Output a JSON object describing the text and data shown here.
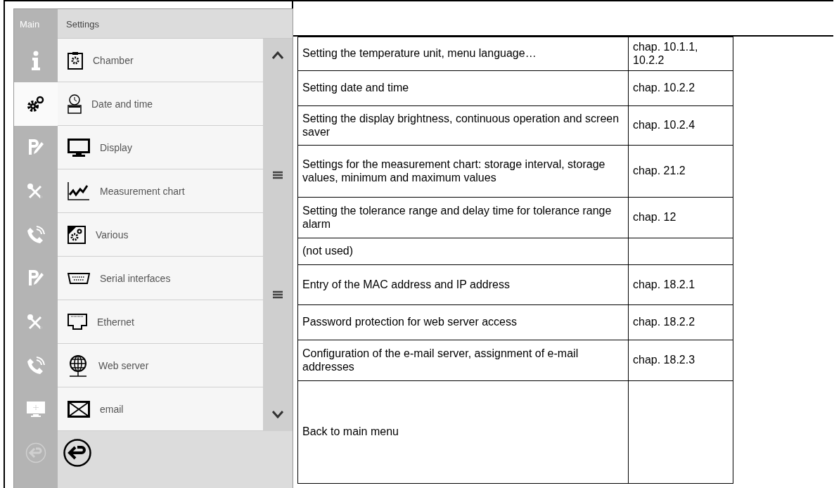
{
  "screen": {
    "main_label": "Main",
    "title": "Settings",
    "sidebar": [
      {
        "kind": "info",
        "selected": false
      },
      {
        "kind": "gears",
        "selected": true
      },
      {
        "kind": "program",
        "selected": false
      },
      {
        "kind": "service",
        "selected": false
      },
      {
        "kind": "contact",
        "selected": false
      },
      {
        "kind": "program",
        "selected": false
      },
      {
        "kind": "service",
        "selected": false
      },
      {
        "kind": "contact",
        "selected": false
      },
      {
        "kind": "monitor",
        "selected": false
      },
      {
        "kind": "back",
        "selected": false,
        "disabled": true
      }
    ],
    "items": [
      {
        "kind": "chamber",
        "label": "Chamber"
      },
      {
        "kind": "clock",
        "label": "Date and time"
      },
      {
        "kind": "display",
        "label": "Display"
      },
      {
        "kind": "chart",
        "label": "Measurement chart"
      },
      {
        "kind": "various",
        "label": "Various"
      },
      {
        "kind": "serial",
        "label": "Serial interfaces"
      },
      {
        "kind": "ethernet",
        "label": "Ethernet"
      },
      {
        "kind": "globe",
        "label": "Web server"
      },
      {
        "kind": "mail",
        "label": "email"
      }
    ]
  },
  "table": {
    "rows": [
      {
        "description": "Setting the temperature unit, menu language…",
        "reference": "chap. 10.1.1, 10.2.2"
      },
      {
        "description": "Setting date and time",
        "reference": "chap. 10.2.2"
      },
      {
        "description": "Setting the display brightness, continuous operation and screen saver",
        "reference": "chap. 10.2.4"
      },
      {
        "description": "Settings for the measurement chart: storage interval, storage values, minimum and maximum values",
        "reference": "chap. 21.2"
      },
      {
        "description": "Setting the tolerance range and delay time for tolerance range alarm",
        "reference": "chap. 12"
      },
      {
        "description": "(not used)",
        "reference": ""
      },
      {
        "description": "Entry of the MAC address and IP address",
        "reference": "chap. 18.2.1"
      },
      {
        "description": "Password protection for web server access",
        "reference": "chap. 18.2.2"
      },
      {
        "description": "Configuration of the e-mail server, assignment of e-mail addresses",
        "reference": "chap. 18.2.3"
      },
      {
        "description": "Back to main menu",
        "reference": ""
      }
    ]
  }
}
